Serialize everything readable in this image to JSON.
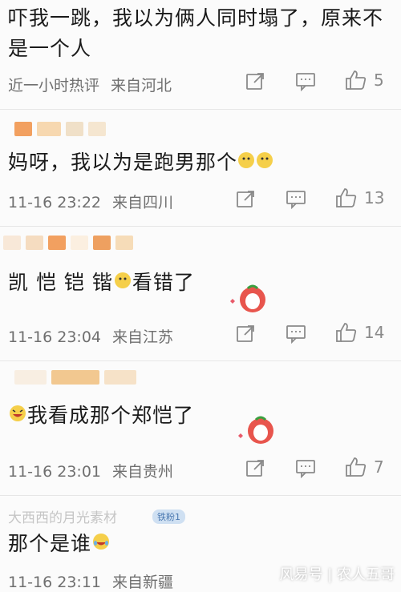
{
  "comments": [
    {
      "text1": "吓我一跳，我以为俩人同时塌了，原来不",
      "text2": "是一个人",
      "time": "近一小时热评",
      "source": "来自河北",
      "likes": "5"
    },
    {
      "text": "妈呀，我以为是跑男那个",
      "time": "11-16 23:22",
      "source": "来自四川",
      "likes": "13"
    },
    {
      "text": "凯 恺 铠 锴",
      "text_after": "看错了",
      "time": "11-16 23:04",
      "source": "来自江苏",
      "likes": "14"
    },
    {
      "text": "我看成那个郑恺了",
      "time": "11-16 23:01",
      "source": "来自贵州",
      "likes": "7"
    },
    {
      "text": "那个是谁",
      "time": "11-16 23:11",
      "source": "来自新疆",
      "likes": ""
    }
  ],
  "badge": "铁粉1",
  "partial_name": "大西西的月光素材",
  "watermark": "风易号 | 农人五哥",
  "colors": {
    "accent": "#f0a050",
    "icon": "#8a8a8a"
  }
}
